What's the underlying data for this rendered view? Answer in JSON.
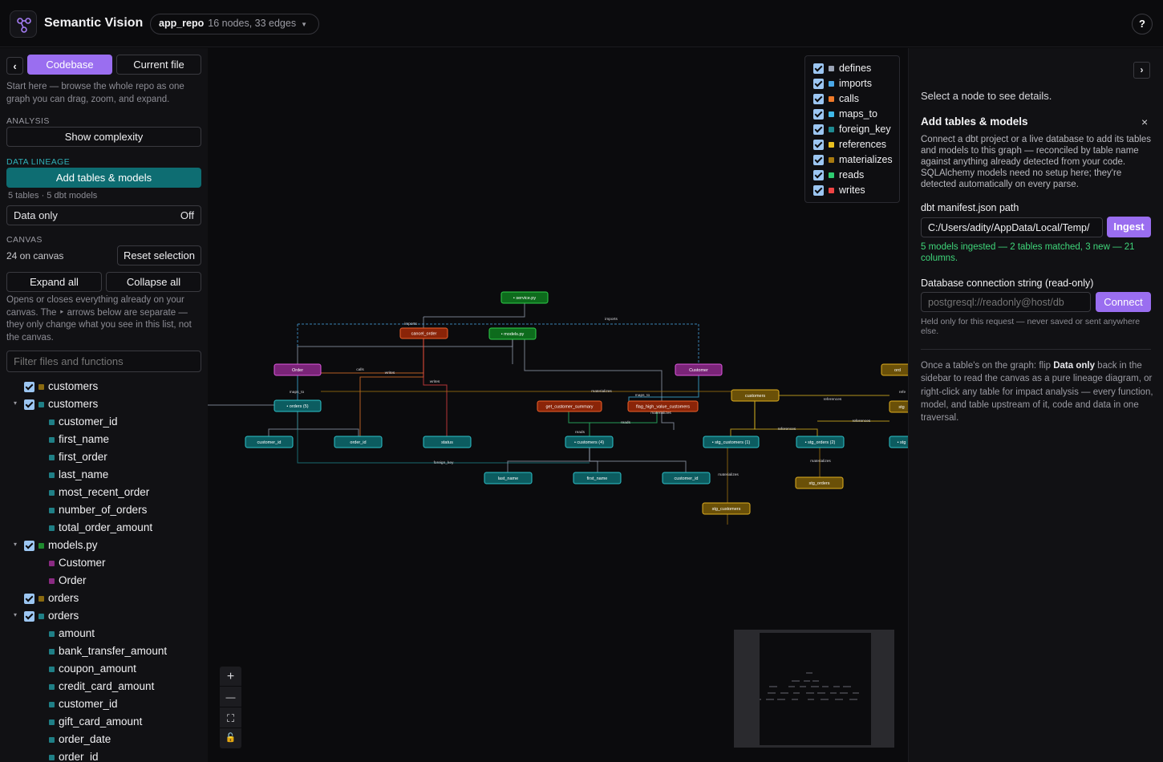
{
  "topbar": {
    "app_title": "Semantic Vision",
    "repo_name": "app_repo",
    "repo_meta": "16 nodes, 33 edges",
    "help_label": "?"
  },
  "sidebar": {
    "collapse_icon": "chevron-left-icon",
    "collapse_label": "‹",
    "tabs": [
      {
        "label": "Codebase",
        "active": true
      },
      {
        "label": "Current file",
        "active": false
      }
    ],
    "intro": "Start here — browse the whole repo as one graph you can drag, zoom, and expand.",
    "analysis_label": "ANALYSIS",
    "show_complexity": "Show complexity",
    "lineage_label": "DATA LINEAGE",
    "add_tables": "Add tables & models",
    "lineage_meta": "5 tables · 5 dbt models",
    "data_only_label": "Data only",
    "data_only_value": "Off",
    "canvas_label": "CANVAS",
    "on_canvas": "24 on canvas",
    "reset_selection": "Reset selection",
    "expand_all": "Expand all",
    "collapse_all": "Collapse all",
    "expand_hint": "Opens or closes everything already on your canvas. The ‣ arrows below are separate — they only change what you see in this list, not the canvas.",
    "filter_placeholder": "Filter files and functions",
    "tree": [
      {
        "label": "customers",
        "level": 0,
        "checkbox": true,
        "toggle": false,
        "color": "#8a6a10"
      },
      {
        "label": "customers",
        "level": 0,
        "checkbox": true,
        "toggle": true,
        "color": "#1f7f86"
      },
      {
        "label": "customer_id",
        "level": 1,
        "checkbox": false,
        "toggle": false,
        "color": "#1f7f86"
      },
      {
        "label": "first_name",
        "level": 1,
        "checkbox": false,
        "toggle": false,
        "color": "#1f7f86"
      },
      {
        "label": "first_order",
        "level": 1,
        "checkbox": false,
        "toggle": false,
        "color": "#1f7f86"
      },
      {
        "label": "last_name",
        "level": 1,
        "checkbox": false,
        "toggle": false,
        "color": "#1f7f86"
      },
      {
        "label": "most_recent_order",
        "level": 1,
        "checkbox": false,
        "toggle": false,
        "color": "#1f7f86"
      },
      {
        "label": "number_of_orders",
        "level": 1,
        "checkbox": false,
        "toggle": false,
        "color": "#1f7f86"
      },
      {
        "label": "total_order_amount",
        "level": 1,
        "checkbox": false,
        "toggle": false,
        "color": "#1f7f86"
      },
      {
        "label": "models.py",
        "level": 0,
        "checkbox": true,
        "toggle": true,
        "color": "#1e8a2e"
      },
      {
        "label": "Customer",
        "level": 1,
        "checkbox": false,
        "toggle": false,
        "color": "#8a2a82"
      },
      {
        "label": "Order",
        "level": 1,
        "checkbox": false,
        "toggle": false,
        "color": "#8a2a82"
      },
      {
        "label": "orders",
        "level": 0,
        "checkbox": true,
        "toggle": false,
        "color": "#8a6a10"
      },
      {
        "label": "orders",
        "level": 0,
        "checkbox": true,
        "toggle": true,
        "color": "#1f7f86"
      },
      {
        "label": "amount",
        "level": 1,
        "checkbox": false,
        "toggle": false,
        "color": "#1f7f86"
      },
      {
        "label": "bank_transfer_amount",
        "level": 1,
        "checkbox": false,
        "toggle": false,
        "color": "#1f7f86"
      },
      {
        "label": "coupon_amount",
        "level": 1,
        "checkbox": false,
        "toggle": false,
        "color": "#1f7f86"
      },
      {
        "label": "credit_card_amount",
        "level": 1,
        "checkbox": false,
        "toggle": false,
        "color": "#1f7f86"
      },
      {
        "label": "customer_id",
        "level": 1,
        "checkbox": false,
        "toggle": false,
        "color": "#1f7f86"
      },
      {
        "label": "gift_card_amount",
        "level": 1,
        "checkbox": false,
        "toggle": false,
        "color": "#1f7f86"
      },
      {
        "label": "order_date",
        "level": 1,
        "checkbox": false,
        "toggle": false,
        "color": "#1f7f86"
      },
      {
        "label": "order_id",
        "level": 1,
        "checkbox": false,
        "toggle": false,
        "color": "#1f7f86"
      }
    ]
  },
  "legend": [
    {
      "label": "defines",
      "color": "#9aa3b5"
    },
    {
      "label": "imports",
      "color": "#4aa8e8"
    },
    {
      "label": "calls",
      "color": "#f07a2a"
    },
    {
      "label": "maps_to",
      "color": "#3fb8e8"
    },
    {
      "label": "foreign_key",
      "color": "#1f8a92"
    },
    {
      "label": "references",
      "color": "#e8c020"
    },
    {
      "label": "materializes",
      "color": "#a87a10"
    },
    {
      "label": "reads",
      "color": "#2ecc71"
    },
    {
      "label": "writes",
      "color": "#ef4444"
    }
  ],
  "graph": {
    "nodes": [
      {
        "label": "• service.py",
        "kind": "file"
      },
      {
        "label": "cancel_order",
        "kind": "function"
      },
      {
        "label": "• models.py",
        "kind": "file"
      },
      {
        "label": "Order",
        "kind": "model"
      },
      {
        "label": "Customer",
        "kind": "model"
      },
      {
        "label": "• orders (5)",
        "kind": "table"
      },
      {
        "label": "get_customer_summary",
        "kind": "function"
      },
      {
        "label": "flag_high_value_customers",
        "kind": "function"
      },
      {
        "label": "customers",
        "kind": "dbt"
      },
      {
        "label": "ord",
        "kind": "dbt"
      },
      {
        "label": "stg",
        "kind": "dbt"
      },
      {
        "label": "customer_id",
        "kind": "column"
      },
      {
        "label": "order_id",
        "kind": "column"
      },
      {
        "label": "status",
        "kind": "column"
      },
      {
        "label": "• customers (4)",
        "kind": "table"
      },
      {
        "label": "• stg_customers (1)",
        "kind": "table"
      },
      {
        "label": "• stg_orders (2)",
        "kind": "table"
      },
      {
        "label": "• stg",
        "kind": "table"
      },
      {
        "label": "last_name",
        "kind": "column"
      },
      {
        "label": "first_name",
        "kind": "column"
      },
      {
        "label": "customer_id",
        "kind": "column"
      },
      {
        "label": "stg_orders",
        "kind": "dbt"
      },
      {
        "label": "stg_customers",
        "kind": "dbt"
      }
    ],
    "edge_labels": [
      "imports",
      "imports",
      "calls",
      "writes",
      "writes",
      "maps_to",
      "materializes",
      "maps_to",
      "materializes",
      "reads",
      "reads",
      "references",
      "references",
      "references",
      "foreign_key",
      "materializes",
      "materializes",
      "refe"
    ]
  },
  "zoom": {
    "zoom_in_icon": "plus-icon",
    "zoom_out_icon": "minus-icon",
    "fit_icon": "fit-view-icon",
    "lock_icon": "lock-icon",
    "zoom_in": "+",
    "zoom_out": "—",
    "fit": "⛶",
    "lock": "🔓"
  },
  "details": {
    "expand_label": "›",
    "empty_hint": "Select a node to see details.",
    "title": "Add tables & models",
    "close_label": "×",
    "description": "Connect a dbt project or a live database to add its tables and models to this graph — reconciled by table name against anything already detected from your code. SQLAlchemy models need no setup here; they're detected automatically on every parse.",
    "manifest_label": "dbt manifest.json path",
    "manifest_value": "C:/Users/adity/AppData/Local/Temp/",
    "ingest_label": "Ingest",
    "ingest_status": "5 models ingested — 2 tables matched, 3 new — 21 columns.",
    "db_label": "Database connection string (read-only)",
    "db_placeholder": "postgresql://readonly@host/db",
    "connect_label": "Connect",
    "db_hint": "Held only for this request — never saved or sent anywhere else.",
    "footer_pre": "Once a table's on the graph: flip ",
    "footer_bold": "Data only",
    "footer_post": " back in the sidebar to read the canvas as a pure lineage diagram, or right-click any table for impact analysis — every function, model, and table upstream of it, code and data in one traversal."
  }
}
